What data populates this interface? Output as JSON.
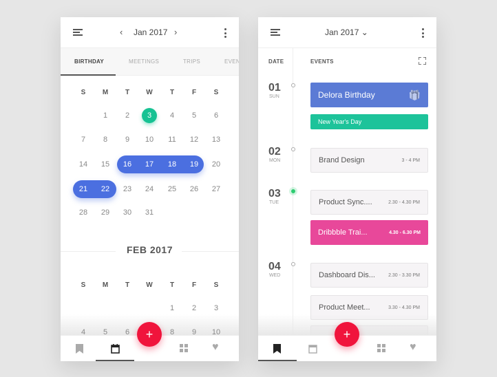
{
  "colors": {
    "blue": "#4b6fe0",
    "green": "#16c293",
    "red": "#f0143c",
    "pink": "#e8489a"
  },
  "left": {
    "header": {
      "title": "Jan 2017",
      "prev_icon": "chevron-left-icon",
      "next_icon": "chevron-right-icon"
    },
    "tabs": [
      "BIRTHDAY",
      "MEETINGS",
      "TRIPS",
      "EVEN"
    ],
    "active_tab": 0,
    "weekdays": [
      "S",
      "M",
      "T",
      "W",
      "T",
      "F",
      "S"
    ],
    "jan": {
      "rows": [
        [
          "",
          "1",
          "2",
          "3",
          "4",
          "5",
          "6"
        ],
        [
          "7",
          "8",
          "9",
          "10",
          "11",
          "12",
          "13"
        ],
        [
          "14",
          "15",
          "16",
          "17",
          "18",
          "19",
          "20"
        ],
        [
          "21",
          "22",
          "23",
          "24",
          "25",
          "26",
          "27"
        ],
        [
          "28",
          "29",
          "30",
          "31",
          "",
          "",
          ""
        ]
      ],
      "today": "3",
      "selected": [
        "16",
        "17",
        "18",
        "19",
        "21",
        "22"
      ]
    },
    "feb": {
      "title": "FEB 2017",
      "rows": [
        [
          "",
          "",
          "",
          "",
          "1",
          "2",
          "3"
        ],
        [
          "4",
          "5",
          "6",
          "7",
          "8",
          "9",
          "10"
        ]
      ]
    }
  },
  "right": {
    "header": {
      "title": "Jan 2017 ⌄"
    },
    "col_date": "DATE",
    "col_events": "EVENTS",
    "days": [
      {
        "num": "01",
        "name": "SUN",
        "active": false
      },
      {
        "num": "02",
        "name": "MON",
        "active": false
      },
      {
        "num": "03",
        "name": "TUE",
        "active": true
      },
      {
        "num": "04",
        "name": "WED",
        "active": false
      }
    ],
    "events": [
      {
        "title": "Delora Birthday",
        "time": "",
        "style": "blue",
        "icon": "gift-icon"
      },
      {
        "title": "New Year's Day",
        "time": "",
        "style": "green"
      },
      {
        "title": "Brand Design",
        "time": "3 - 4 PM",
        "style": "plain"
      },
      {
        "title": "Product Sync....",
        "time": "2.30 - 4.30 PM",
        "style": "plain"
      },
      {
        "title": "Dribbble Trai...",
        "time": "4.30 - 6.30 PM",
        "style": "pink"
      },
      {
        "title": "Dashboard Dis...",
        "time": "2.30 - 3.30 PM",
        "style": "plain"
      },
      {
        "title": "Product Meet...",
        "time": "3.30 - 4.30 PM",
        "style": "plain"
      }
    ]
  },
  "fab": "+",
  "nav_icons": [
    "bookmark-icon",
    "calendar-icon",
    "grid-icon",
    "heart-icon"
  ]
}
